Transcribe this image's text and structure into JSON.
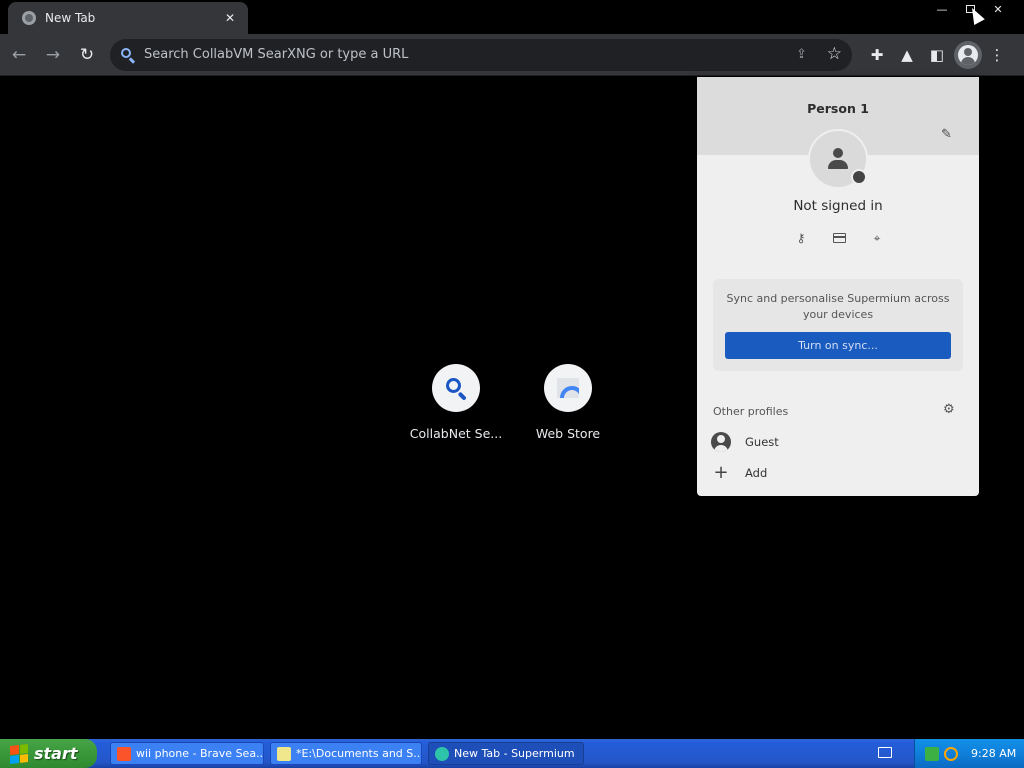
{
  "browser": {
    "tab": {
      "title": "New Tab",
      "close_glyph": "✕"
    },
    "window_controls": {
      "minimize": "—",
      "close": "✕"
    },
    "toolbar": {
      "back_glyph": "←",
      "forward_glyph": "→",
      "reload_glyph": "↻",
      "omnibox_placeholder": "Search CollabVM SearXNG or type a URL",
      "share_glyph": "⇪",
      "star_glyph": "☆",
      "extensions_glyph": "✚",
      "labs_glyph": "▲",
      "sidepanel_glyph": "◧",
      "menu_glyph": "⋮"
    }
  },
  "new_tab": {
    "shortcuts": [
      {
        "title": "CollabNet Se...",
        "icon": "search-icon"
      },
      {
        "title": "Web Store",
        "icon": "web-store-icon"
      }
    ]
  },
  "profile_menu": {
    "name": "Person 1",
    "edit_glyph": "✎",
    "status": "Not signed in",
    "quick_icons": [
      "key-icon",
      "card-icon",
      "location-icon"
    ],
    "key_glyph": "⚷",
    "location_glyph": "⌖",
    "sync_text": "Sync and personalise Supermium across your devices",
    "sync_button": "Turn on sync...",
    "other_profiles_label": "Other profiles",
    "gear_glyph": "⚙",
    "guest_label": "Guest",
    "add_label": "Add",
    "add_glyph": "+"
  },
  "taskbar": {
    "start_label": "start",
    "tasks": [
      {
        "label": "wii phone - Brave Sea...",
        "icon": "brave-icon",
        "color": "#fb542b",
        "active": false
      },
      {
        "label": "*E:\\Documents and S...",
        "icon": "notepad-icon",
        "color": "#f0e68c",
        "active": false
      },
      {
        "label": "New Tab - Supermium",
        "icon": "supermium-icon",
        "color": "#2ec4a9",
        "active": true
      }
    ],
    "clock": "9:28 AM"
  },
  "colors": {
    "accent_blue": "#1a5bbf",
    "omnibox_icon": "#8ab4f8",
    "taskbar_blue": "#245edb",
    "start_green": "#3c9a3c"
  }
}
